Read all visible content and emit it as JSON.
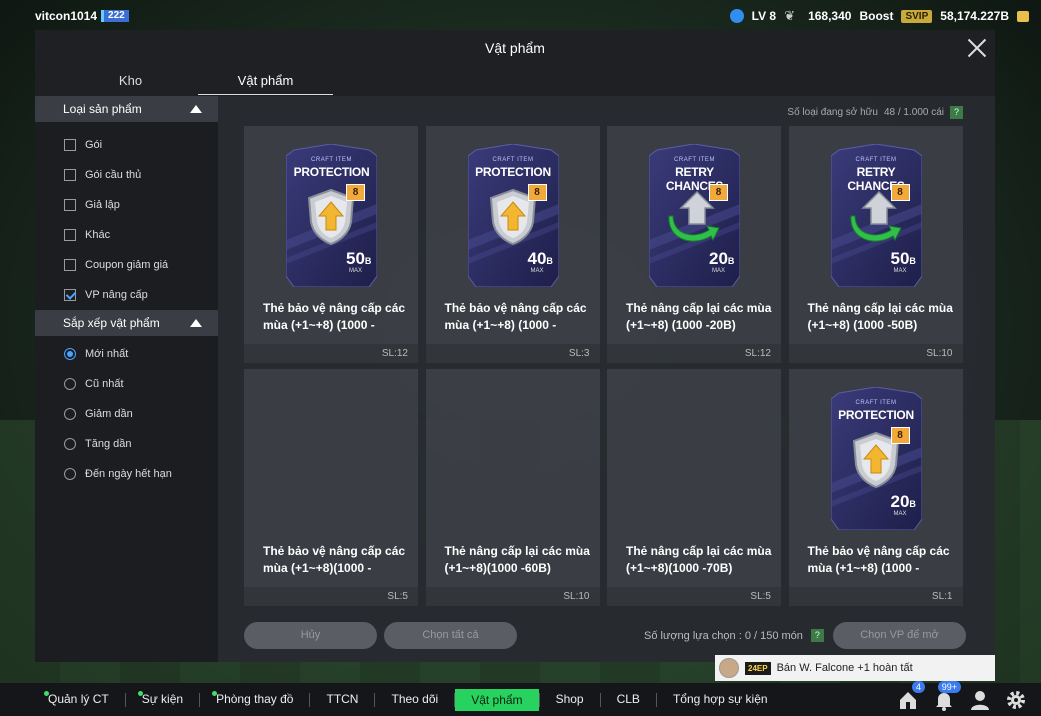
{
  "topbar": {
    "username": "vitcon1014",
    "user_level": "222",
    "level": "LV 8",
    "trophies": "168,340",
    "boost": "Boost",
    "svip": "SVIP",
    "bp": "58,174.227B"
  },
  "modal": {
    "title": "Vật phẩm",
    "tabs": [
      {
        "label": "Kho"
      },
      {
        "label": "Vật phẩm"
      }
    ],
    "owned_label": "Số loại đang sở hữu",
    "owned_value": "48 / 1.000 cái",
    "help": "?"
  },
  "sidebar": {
    "product_type": {
      "title": "Loại sản phẩm",
      "options": [
        {
          "label": "Gói",
          "checked": false
        },
        {
          "label": "Gói cầu thủ",
          "checked": false
        },
        {
          "label": "Giả lập",
          "checked": false
        },
        {
          "label": "Khác",
          "checked": false
        },
        {
          "label": "Coupon giảm giá",
          "checked": false
        },
        {
          "label": "VP nâng cấp",
          "checked": true
        }
      ]
    },
    "sort": {
      "title": "Sắp xếp vật phẩm",
      "options": [
        {
          "label": "Mới nhất",
          "selected": true
        },
        {
          "label": "Cũ nhất",
          "selected": false
        },
        {
          "label": "Giảm dần",
          "selected": false
        },
        {
          "label": "Tăng dần",
          "selected": false
        },
        {
          "label": "Đến ngày hết hạn",
          "selected": false
        }
      ]
    }
  },
  "items": [
    {
      "art": "protection",
      "kicker": "CRAFT ITEM",
      "banner": "PROTECTION",
      "value": "50",
      "unit": "B",
      "badge": "8",
      "max": "MAX",
      "name_1": "Thẻ bảo vệ nâng cấp các",
      "name_2": "mùa (+1~+8) (1000 -",
      "qty": "SL:12"
    },
    {
      "art": "protection",
      "kicker": "CRAFT ITEM",
      "banner": "PROTECTION",
      "value": "40",
      "unit": "B",
      "badge": "8",
      "max": "MAX",
      "name_1": "Thẻ bảo vệ nâng cấp các",
      "name_2": "mùa (+1~+8) (1000 -",
      "qty": "SL:3"
    },
    {
      "art": "retry",
      "kicker": "CRAFT ITEM",
      "banner": "RETRY CHANCES",
      "value": "20",
      "unit": "B",
      "badge": "8",
      "max": "MAX",
      "name_1": "Thẻ nâng cấp lại các mùa",
      "name_2": "(+1~+8) (1000 -20B)",
      "qty": "SL:12"
    },
    {
      "art": "retry",
      "kicker": "CRAFT ITEM",
      "banner": "RETRY CHANCES",
      "value": "50",
      "unit": "B",
      "badge": "8",
      "max": "MAX",
      "name_1": "Thẻ nâng cấp lại các mùa",
      "name_2": "(+1~+8) (1000 -50B)",
      "qty": "SL:10"
    },
    {
      "art": "none",
      "name_1": "Thẻ bảo vệ nâng cấp các",
      "name_2": "mùa (+1~+8)(1000 -",
      "qty": "SL:5"
    },
    {
      "art": "none",
      "name_1": "Thẻ nâng cấp lại các mùa",
      "name_2": "(+1~+8)(1000 -60B)",
      "qty": "SL:10"
    },
    {
      "art": "none",
      "name_1": "Thẻ nâng cấp lại các mùa",
      "name_2": "(+1~+8)(1000 -70B)",
      "qty": "SL:5"
    },
    {
      "art": "protection",
      "kicker": "CRAFT ITEM",
      "banner": "PROTECTION",
      "value": "20",
      "unit": "B",
      "badge": "8",
      "max": "MAX",
      "name_1": "Thẻ bảo vệ nâng cấp các",
      "name_2": "mùa (+1~+8) (1000 -",
      "qty": "SL:1"
    }
  ],
  "actions": {
    "cancel": "Hủy",
    "select_all": "Chọn tất cả",
    "selected_count": "Số lượng lựa chọn : 0 / 150 món",
    "help": "?",
    "select_to_open": "Chọn VP để mở"
  },
  "notification": {
    "badge": "24EP",
    "text": "Bán W. Falcone +1 hoàn tất"
  },
  "nav": {
    "items": [
      {
        "label": "Quản lý CT",
        "dot": true
      },
      {
        "label": "Sự kiện",
        "dot": true
      },
      {
        "label": "Phòng thay đồ",
        "dot": true
      },
      {
        "label": "TTCN",
        "dot": false
      },
      {
        "label": "Theo dõi",
        "dot": false
      },
      {
        "label": "Vật phẩm",
        "dot": false,
        "active": true
      },
      {
        "label": "Shop",
        "dot": false
      },
      {
        "label": "CLB",
        "dot": false
      },
      {
        "label": "Tổng hợp sự kiện",
        "dot": false
      }
    ],
    "home_badge": "4",
    "bell_badge": "99+"
  },
  "colors": {
    "accent_green": "#27d35e",
    "check_blue": "#4aa3ff",
    "card_purple": "#2e2f66",
    "gold": "#e8c04b"
  }
}
